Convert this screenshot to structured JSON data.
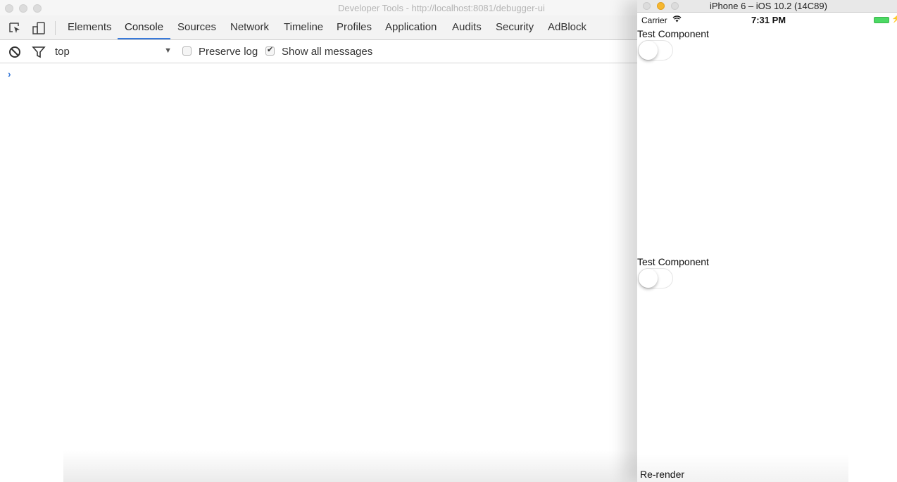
{
  "devtools": {
    "window_title": "Developer Tools - http://localhost:8081/debugger-ui",
    "tabs": [
      {
        "label": "Elements"
      },
      {
        "label": "Console",
        "active": true
      },
      {
        "label": "Sources"
      },
      {
        "label": "Network"
      },
      {
        "label": "Timeline"
      },
      {
        "label": "Profiles"
      },
      {
        "label": "Application"
      },
      {
        "label": "Audits"
      },
      {
        "label": "Security"
      },
      {
        "label": "AdBlock"
      }
    ],
    "toolbar": {
      "context": "top",
      "preserve_log_label": "Preserve log",
      "preserve_log_checked": false,
      "show_all_label": "Show all messages",
      "show_all_checked": true
    },
    "console_prompt": ">"
  },
  "simulator": {
    "window_title": "iPhone 6 – iOS 10.2 (14C89)",
    "status_bar": {
      "carrier": "Carrier",
      "wifi_icon": "wifi-icon",
      "time": "7:31 PM",
      "battery_icon": "battery-charging-icon",
      "battery_color": "#4cd964"
    },
    "components": [
      {
        "label": "Test Component",
        "switch_on": false
      },
      {
        "label": "Test Component",
        "switch_on": false
      }
    ],
    "rerender_label": "Re-render"
  }
}
